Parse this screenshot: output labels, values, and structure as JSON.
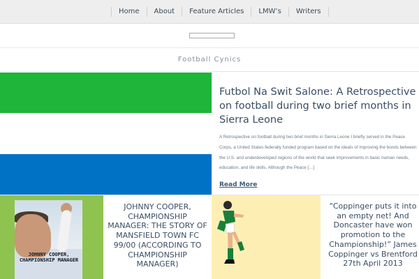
{
  "nav": {
    "items": [
      {
        "label": "Home"
      },
      {
        "label": "About"
      },
      {
        "label": "Feature Articles"
      },
      {
        "label": "LMW’s"
      },
      {
        "label": "Writers"
      }
    ]
  },
  "search": {
    "placeholder": ""
  },
  "site": {
    "title": "Football Cynics"
  },
  "featured": {
    "title": "Futbol Na Swit Salone: A Retrospective on football during two brief months in Sierra Leone",
    "excerpt": "A Retrospective on football during two brief months in Sierra Leone I briefly served in the Peace Corps, a United States federally funded program based on the ideals of improving the bonds between the U.S. and underdeveloped regions of the world that seek improvements in basic human needs, education, and life skills. Although the Peace […]",
    "read_more": "Read More",
    "flag_colors": [
      "#1eb53a",
      "#ffffff",
      "#0072c6"
    ]
  },
  "cards": [
    {
      "title": "JOHNNY COOPER, CHAMPIONSHIP MANAGER: THE STORY OF MANSFIELD TOWN FC 99/00 (ACCORDING TO CHAMPIONSHIP MANAGER)",
      "image": {
        "icon": "book-cover-icon",
        "cover_title": "JOHNNY COOPER, CHAMPIONSHIP MANAGER",
        "background": "#8fc34f"
      }
    },
    {
      "title": "“Coppinger puts it into an empty net! And Doncaster have won promotion to the Championship!” James Coppinger vs Brentford 27th April 2013",
      "image": {
        "icon": "footballer-illustration-icon",
        "background": "#fdefb4"
      }
    }
  ]
}
